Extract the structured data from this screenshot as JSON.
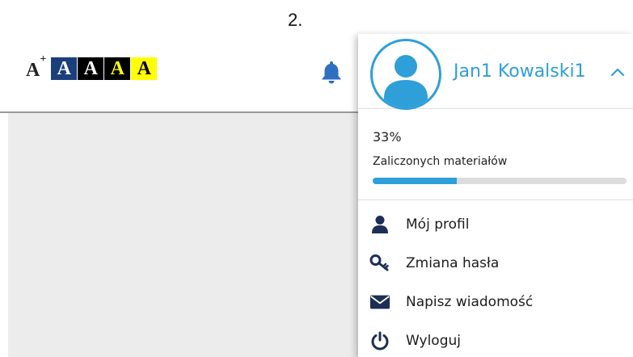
{
  "step": "2.",
  "accessibility": {
    "font_size_label": "A",
    "font_size_sup": "+",
    "contrast_options": [
      "A",
      "A",
      "A",
      "A"
    ]
  },
  "header": {
    "notifications_icon": "bell-icon"
  },
  "user_menu": {
    "user_name": "Jan1 Kowalski1",
    "avatar_icon": "user-avatar-icon",
    "toggle_icon": "chevron-up-icon",
    "progress": {
      "percent_text": "33%",
      "percent_value": 33,
      "label": "Zaliczonych materiałów"
    },
    "items": [
      {
        "label": "Mój profil",
        "icon": "user-icon"
      },
      {
        "label": "Zmiana hasła",
        "icon": "key-icon"
      },
      {
        "label": "Napisz wiadomość",
        "icon": "envelope-icon"
      },
      {
        "label": "Wyloguj",
        "icon": "power-icon"
      }
    ]
  },
  "colors": {
    "accent": "#2e9fd8",
    "contrast_blue": "#1a3f7a",
    "contrast_yellow": "#ffff00",
    "bell": "#2f6fc0",
    "menu_icon": "#1d2f55"
  }
}
